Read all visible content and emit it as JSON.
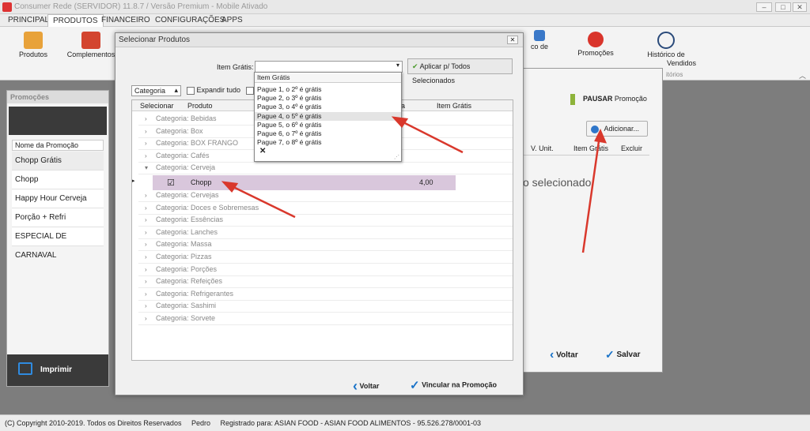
{
  "app": {
    "title": "Consumer Rede (SERVIDOR) 11.8.7 / Versão Premium - Mobile Ativado"
  },
  "menu": [
    "PRINCIPAL",
    "PRODUTOS",
    "FINANCEIRO",
    "CONFIGURAÇÕES",
    "APPS"
  ],
  "ribbon": {
    "produtos": "Produtos",
    "complementos": "Complementos",
    "mais_vendidos_partial": "co de",
    "promocoes": "Promoções",
    "historico": "Histórico de",
    "historico2": "Vendidos",
    "section": "itórios"
  },
  "left_panel": {
    "title": "Promoções",
    "column": "Nome da Promoção",
    "items": [
      "Chopp Grátis",
      "Chopp",
      "Happy Hour Cerveja",
      "Porção + Refri",
      "ESPECIAL DE CARNAVAL"
    ],
    "print_label": "Imprimir"
  },
  "right_panel": {
    "pause_bold": "PAUSAR",
    "pause_rest": "Promoção",
    "add_label": "Adicionar...",
    "cols": [
      "V. Unit.",
      "Item Grátis",
      "Excluir"
    ],
    "empty_text": "o selecionado.",
    "back": "Voltar",
    "save": "Salvar"
  },
  "modal": {
    "title": "Selecionar Produtos",
    "item_gratis_label": "Item Grátis:",
    "apply_label": "Aplicar p/ Todos Selecionados",
    "group_by": "Categoria",
    "expand_label": "Expandir tudo",
    "headers": {
      "select": "Selecionar",
      "product": "Produto",
      "price_partial": "a",
      "free": "Item Grátis"
    },
    "categories": [
      "Categoria: Bebidas",
      "Categoria: Box",
      "Categoria: BOX FRANGO",
      "Categoria: Cafés",
      "Categoria: Cerveja",
      "Categoria: Cervejas",
      "Categoria: Doces e Sobremesas",
      "Categoria: Essências",
      "Categoria: Lanches",
      "Categoria: Massa",
      "Categoria: Pizzas",
      "Categoria: Porções",
      "Categoria: Refeições",
      "Categoria: Refrigerantes",
      "Categoria: Sashimi",
      "Categoria: Sorvete"
    ],
    "row": {
      "name": "Chopp",
      "price": "4,00"
    },
    "back": "Voltar",
    "link": "Vincular na Promoção"
  },
  "dropdown": {
    "header": "Item Grátis",
    "options": [
      "Pague 1, o 2º é grátis",
      "Pague 2, o 3º é grátis",
      "Pague 3, o 4º é grátis",
      "Pague 4, o 5º é grátis",
      "Pague 5, o 6º é grátis",
      "Pague 6, o 7º é grátis",
      "Pague 7, o 8º é grátis"
    ],
    "clear": "✕"
  },
  "status": {
    "copyright": "(C) Copyright 2010-2019. Todos os Direitos Reservados",
    "user": "Pedro",
    "reg": "Registrado para: ASIAN FOOD - ASIAN FOOD ALIMENTOS - 95.526.278/0001-03"
  },
  "colors": {
    "accent_blue": "#1a73c8",
    "highlight_row": "#d9c7dc",
    "arrow": "#d9382c"
  }
}
